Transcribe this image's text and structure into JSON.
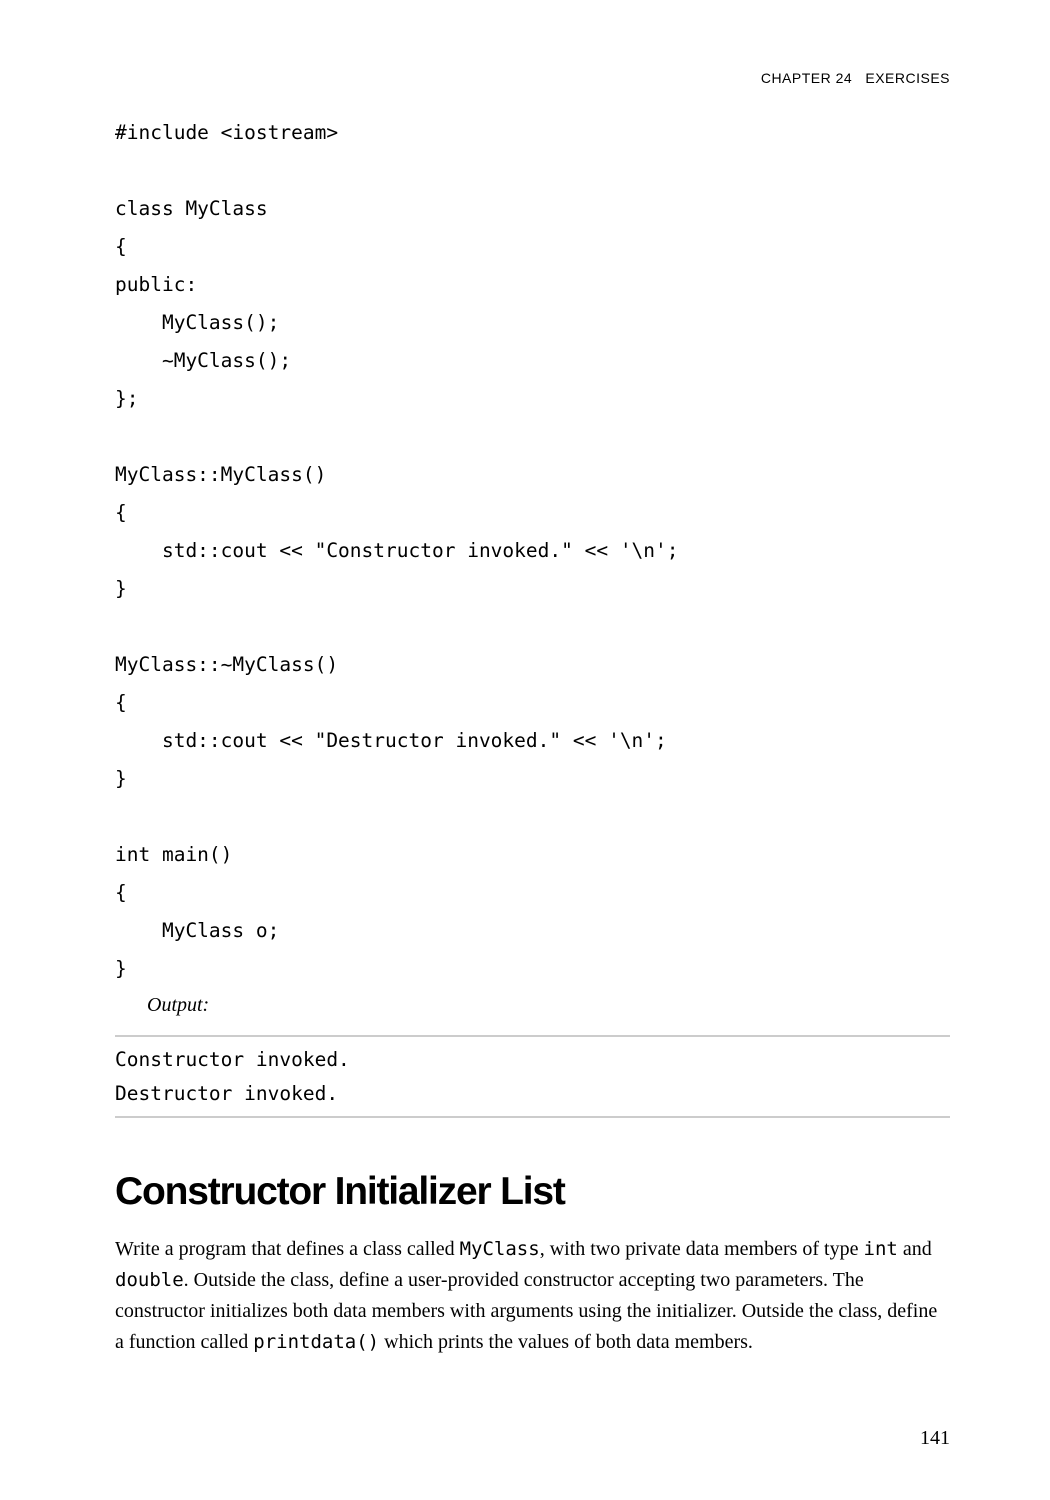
{
  "header": {
    "chapter": "CHAPTER 24",
    "title": "EXERCISES"
  },
  "code": "#include <iostream>\n\nclass MyClass\n{\npublic:\n    MyClass();\n    ~MyClass();\n};\n\nMyClass::MyClass()\n{\n    std::cout << \"Constructor invoked.\" << '\\n';\n}\n\nMyClass::~MyClass()\n{\n    std::cout << \"Destructor invoked.\" << '\\n';\n}\n\nint main()\n{\n    MyClass o;\n}",
  "outputLabel": "Output:",
  "output": "Constructor invoked.\nDestructor invoked.",
  "section": {
    "heading": "Constructor Initializer List",
    "para_parts": {
      "t1": "Write a program that defines a class called ",
      "c1": "MyClass",
      "t2": ", with two private data members of type ",
      "c2": "int",
      "t3": " and ",
      "c3": "double",
      "t4": ". Outside the class, define a user-provided constructor accepting two parameters. The constructor initializes both data members with arguments using the initializer. Outside the class, define a function called ",
      "c4": "printdata()",
      "t5": " which prints the values of both data members."
    }
  },
  "pageNumber": "141"
}
